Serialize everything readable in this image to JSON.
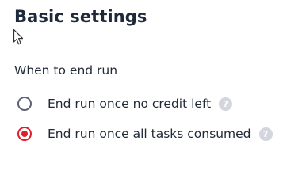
{
  "page": {
    "title": "Basic settings"
  },
  "section": {
    "label": "When to end run"
  },
  "options": [
    {
      "label": "End run once no credit left",
      "checked": false,
      "help_icon": "question-circle-icon",
      "help_glyph": "?"
    },
    {
      "label": "End run once all tasks consumed",
      "checked": true,
      "help_icon": "question-circle-icon",
      "help_glyph": "?"
    }
  ],
  "colors": {
    "accent": "#e11d2e",
    "text": "#1f2937",
    "help_bg": "#d3d6dc"
  },
  "cursor": {
    "icon": "mouse-pointer-icon"
  }
}
